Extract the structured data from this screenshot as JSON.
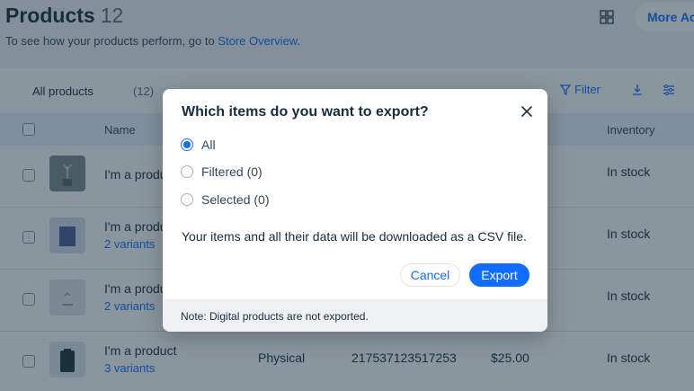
{
  "page": {
    "title": "Products",
    "count": "12",
    "subtitle_prefix": "To see how your products perform, go to ",
    "subtitle_link": "Store Overview",
    "subtitle_suffix": ".",
    "more_actions": "More Actions"
  },
  "toolbar": {
    "all_products": "All products",
    "all_count": "(12)",
    "filter": "Filter"
  },
  "table": {
    "headers": {
      "name": "Name",
      "inventory": "Inventory"
    },
    "rows": [
      {
        "name": "I'm a product",
        "variants": "",
        "type": "",
        "sku": "",
        "price": "",
        "inventory": "In stock"
      },
      {
        "name": "I'm a product",
        "variants": "2 variants",
        "type": "",
        "sku": "",
        "price": "",
        "inventory": "In stock"
      },
      {
        "name": "I'm a product",
        "variants": "2 variants",
        "type": "",
        "sku": "",
        "price": "",
        "inventory": "In stock"
      },
      {
        "name": "I'm a product",
        "variants": "3 variants",
        "type": "Physical",
        "sku": "217537123517253",
        "price": "$25.00",
        "inventory": "In stock"
      }
    ]
  },
  "modal": {
    "title": "Which items do you want to export?",
    "options": [
      {
        "label": "All",
        "checked": true
      },
      {
        "label": "Filtered (0)",
        "checked": false
      },
      {
        "label": "Selected (0)",
        "checked": false
      }
    ],
    "description": "Your items and all their data will be downloaded as a CSV file.",
    "cancel_label": "Cancel",
    "export_label": "Export",
    "note": "Note: Digital products are not exported."
  },
  "colors": {
    "accent": "#116dff",
    "text": "#162d3d",
    "overlay": "rgba(22,45,61,0.5)"
  }
}
